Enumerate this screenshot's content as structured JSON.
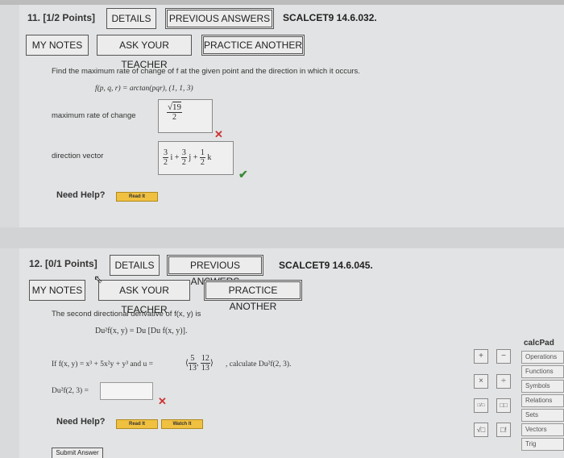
{
  "q11": {
    "header": "11.  [1/2 Points]",
    "details": "DETAILS",
    "prev": "PREVIOUS ANSWERS",
    "code": "SCALCET9 14.6.032.",
    "my_notes": "MY NOTES",
    "ask": "ASK YOUR TEACHER",
    "practice": "PRACTICE ANOTHER",
    "prompt": "Find the maximum rate of change of f at the given point and the direction in which it occurs.",
    "function": "f(p, q, r) = arctan(pqr),   (1, 1, 3)",
    "max_label": "maximum rate of change",
    "max_answer_num": "19",
    "max_answer_den": "2",
    "dir_label": "direction vector",
    "dir_i_num": "3",
    "dir_i_den": "2",
    "dir_i": "i +",
    "dir_j_num": "3",
    "dir_j_den": "2",
    "dir_j": "j +",
    "dir_k_num": "1",
    "dir_k_den": "2",
    "dir_k": "k",
    "need_help": "Need Help?",
    "read_it": "Read It"
  },
  "q12": {
    "header": "12.  [0/1 Points]",
    "details": "DETAILS",
    "prev": "PREVIOUS ANSWERS",
    "code": "SCALCET9 14.6.045.",
    "my_notes": "MY NOTES",
    "ask": "ASK YOUR TEACHER",
    "practice": "PRACTICE ANOTHER",
    "prompt": "The second directional derivative of f(x, y) is",
    "formula": "Du²f(x, y) = Du [Du f(x, y)].",
    "if_text": "If f(x, y) = x³ + 5x²y + y³ and u =",
    "u_num1": "5",
    "u_den1": "13",
    "u_num2": "12",
    "u_den2": "13",
    "calc_text": ", calculate Du²f(2, 3).",
    "answer_label": "Du²f(2, 3) =",
    "answer_value": "",
    "need_help": "Need Help?",
    "read_it": "Read It",
    "watch_it": "Watch It",
    "submit": "Submit Answer"
  },
  "calcpad": {
    "title": "calcPad",
    "items": [
      "Operations",
      "Functions",
      "Symbols",
      "Relations",
      "Sets",
      "Vectors",
      "Trig"
    ],
    "buttons": [
      "+",
      "−",
      "×",
      "÷",
      "□/□",
      "□□",
      "√□",
      "□!"
    ]
  },
  "colors": {
    "wrong": "#c33333",
    "correct": "#3a8a3a",
    "help_button": "#f0c040"
  }
}
